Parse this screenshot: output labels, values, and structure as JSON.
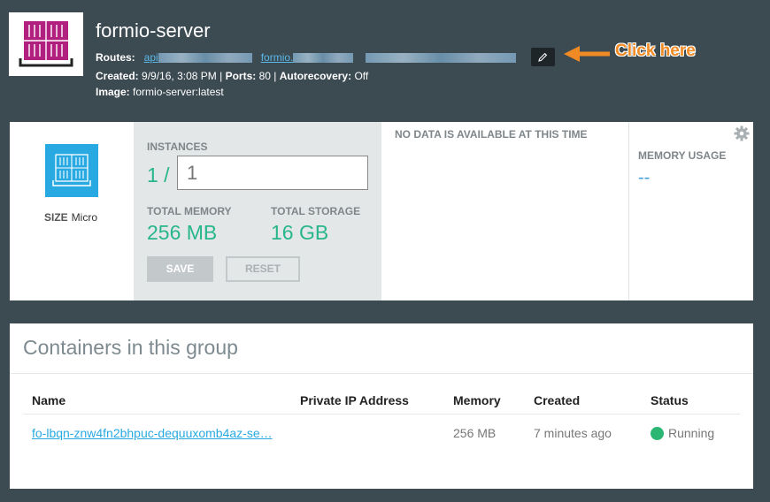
{
  "header": {
    "title": "formio-server",
    "routes_label": "Routes:",
    "routes": [
      "api",
      "formio."
    ],
    "created_label": "Created:",
    "created_value": "9/9/16, 3:08 PM",
    "ports_label": "Ports:",
    "ports_value": "80",
    "autorecovery_label": "Autorecovery:",
    "autorecovery_value": "Off",
    "image_label": "Image:",
    "image_value": "formio-server:latest",
    "edit_icon": "pencil-icon",
    "annotation": "Click here"
  },
  "size": {
    "label": "SIZE",
    "value": "Micro",
    "instances_label": "INSTANCES",
    "instances_prefix": "1 /",
    "instances_value": "1",
    "total_memory_label": "TOTAL MEMORY",
    "total_memory_value": "256 MB",
    "total_storage_label": "TOTAL STORAGE",
    "total_storage_value": "16 GB",
    "save_label": "SAVE",
    "reset_label": "RESET"
  },
  "chart": {
    "no_data": "NO DATA IS AVAILABLE AT THIS TIME",
    "memory_usage_label": "MEMORY USAGE",
    "memory_usage_value": "--",
    "settings_icon": "gear-icon"
  },
  "containers": {
    "title": "Containers in this group",
    "columns": [
      "Name",
      "Private IP Address",
      "Memory",
      "Created",
      "Status"
    ],
    "rows": [
      {
        "name": "fo-lbqn-znw4fn2bhpuc-dequuxomb4az-se…",
        "private_ip": "",
        "memory": "256 MB",
        "created": "7 minutes ago",
        "status": "Running"
      }
    ]
  },
  "colors": {
    "background": "#3c4a52",
    "accent_blue": "#29a9e1",
    "accent_green": "#27b68a",
    "status_running": "#2bb673",
    "annotation_orange": "#f08a24",
    "app_icon_magenta": "#b2207f"
  }
}
